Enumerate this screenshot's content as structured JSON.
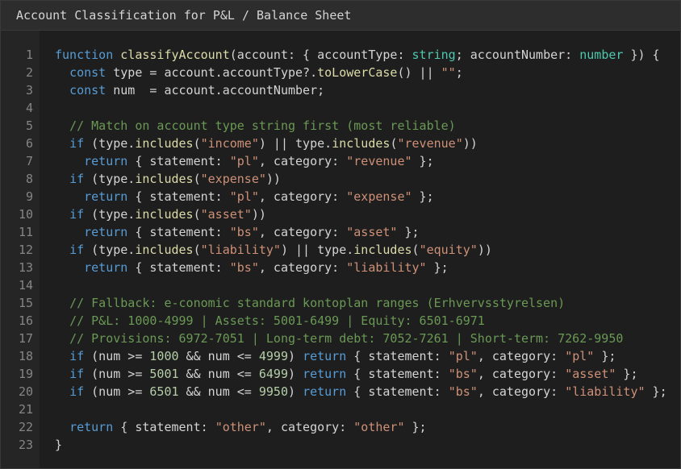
{
  "window": {
    "title": "Account Classification for P&L / Balance Sheet"
  },
  "editor": {
    "colors": {
      "keyword": "#569cd6",
      "function": "#dcdcaa",
      "type": "#4ec9b0",
      "string": "#ce9178",
      "comment": "#6a9955",
      "number": "#b5cea8",
      "plain": "#d4d4d4"
    },
    "lines": [
      [
        [
          "kw",
          "function"
        ],
        [
          "pl",
          " "
        ],
        [
          "fn",
          "classifyAccount"
        ],
        [
          "pl",
          "(account: { accountType: "
        ],
        [
          "ty",
          "string"
        ],
        [
          "pl",
          "; accountNumber: "
        ],
        [
          "ty",
          "number"
        ],
        [
          "pl",
          " }) {"
        ]
      ],
      [
        [
          "pl",
          "  "
        ],
        [
          "kw",
          "const"
        ],
        [
          "pl",
          " type = account.accountType?."
        ],
        [
          "fn",
          "toLowerCase"
        ],
        [
          "pl",
          "() || "
        ],
        [
          "st",
          "\"\""
        ],
        [
          "pl",
          ";"
        ]
      ],
      [
        [
          "pl",
          "  "
        ],
        [
          "kw",
          "const"
        ],
        [
          "pl",
          " num  = account.accountNumber;"
        ]
      ],
      [],
      [
        [
          "pl",
          "  "
        ],
        [
          "cm",
          "// Match on account type string first (most reliable)"
        ]
      ],
      [
        [
          "pl",
          "  "
        ],
        [
          "kw",
          "if"
        ],
        [
          "pl",
          " (type."
        ],
        [
          "fn",
          "includes"
        ],
        [
          "pl",
          "("
        ],
        [
          "st",
          "\"income\""
        ],
        [
          "pl",
          ") || type."
        ],
        [
          "fn",
          "includes"
        ],
        [
          "pl",
          "("
        ],
        [
          "st",
          "\"revenue\""
        ],
        [
          "pl",
          "))"
        ]
      ],
      [
        [
          "pl",
          "    "
        ],
        [
          "kw",
          "return"
        ],
        [
          "pl",
          " { statement: "
        ],
        [
          "st",
          "\"pl\""
        ],
        [
          "pl",
          ", category: "
        ],
        [
          "st",
          "\"revenue\""
        ],
        [
          "pl",
          " };"
        ]
      ],
      [
        [
          "pl",
          "  "
        ],
        [
          "kw",
          "if"
        ],
        [
          "pl",
          " (type."
        ],
        [
          "fn",
          "includes"
        ],
        [
          "pl",
          "("
        ],
        [
          "st",
          "\"expense\""
        ],
        [
          "pl",
          "))"
        ]
      ],
      [
        [
          "pl",
          "    "
        ],
        [
          "kw",
          "return"
        ],
        [
          "pl",
          " { statement: "
        ],
        [
          "st",
          "\"pl\""
        ],
        [
          "pl",
          ", category: "
        ],
        [
          "st",
          "\"expense\""
        ],
        [
          "pl",
          " };"
        ]
      ],
      [
        [
          "pl",
          "  "
        ],
        [
          "kw",
          "if"
        ],
        [
          "pl",
          " (type."
        ],
        [
          "fn",
          "includes"
        ],
        [
          "pl",
          "("
        ],
        [
          "st",
          "\"asset\""
        ],
        [
          "pl",
          "))"
        ]
      ],
      [
        [
          "pl",
          "    "
        ],
        [
          "kw",
          "return"
        ],
        [
          "pl",
          " { statement: "
        ],
        [
          "st",
          "\"bs\""
        ],
        [
          "pl",
          ", category: "
        ],
        [
          "st",
          "\"asset\""
        ],
        [
          "pl",
          " };"
        ]
      ],
      [
        [
          "pl",
          "  "
        ],
        [
          "kw",
          "if"
        ],
        [
          "pl",
          " (type."
        ],
        [
          "fn",
          "includes"
        ],
        [
          "pl",
          "("
        ],
        [
          "st",
          "\"liability\""
        ],
        [
          "pl",
          ") || type."
        ],
        [
          "fn",
          "includes"
        ],
        [
          "pl",
          "("
        ],
        [
          "st",
          "\"equity\""
        ],
        [
          "pl",
          "))"
        ]
      ],
      [
        [
          "pl",
          "    "
        ],
        [
          "kw",
          "return"
        ],
        [
          "pl",
          " { statement: "
        ],
        [
          "st",
          "\"bs\""
        ],
        [
          "pl",
          ", category: "
        ],
        [
          "st",
          "\"liability\""
        ],
        [
          "pl",
          " };"
        ]
      ],
      [],
      [
        [
          "pl",
          "  "
        ],
        [
          "cm",
          "// Fallback: e-conomic standard kontoplan ranges (Erhvervsstyrelsen)"
        ]
      ],
      [
        [
          "pl",
          "  "
        ],
        [
          "cm",
          "// P&L: 1000-4999 | Assets: 5001-6499 | Equity: 6501-6971"
        ]
      ],
      [
        [
          "pl",
          "  "
        ],
        [
          "cm",
          "// Provisions: 6972-7051 | Long-term debt: 7052-7261 | Short-term: 7262-9950"
        ]
      ],
      [
        [
          "pl",
          "  "
        ],
        [
          "kw",
          "if"
        ],
        [
          "pl",
          " (num >= "
        ],
        [
          "nu",
          "1000"
        ],
        [
          "pl",
          " && num <= "
        ],
        [
          "nu",
          "4999"
        ],
        [
          "pl",
          ") "
        ],
        [
          "kw",
          "return"
        ],
        [
          "pl",
          " { statement: "
        ],
        [
          "st",
          "\"pl\""
        ],
        [
          "pl",
          ", category: "
        ],
        [
          "st",
          "\"pl\""
        ],
        [
          "pl",
          " };"
        ]
      ],
      [
        [
          "pl",
          "  "
        ],
        [
          "kw",
          "if"
        ],
        [
          "pl",
          " (num >= "
        ],
        [
          "nu",
          "5001"
        ],
        [
          "pl",
          " && num <= "
        ],
        [
          "nu",
          "6499"
        ],
        [
          "pl",
          ") "
        ],
        [
          "kw",
          "return"
        ],
        [
          "pl",
          " { statement: "
        ],
        [
          "st",
          "\"bs\""
        ],
        [
          "pl",
          ", category: "
        ],
        [
          "st",
          "\"asset\""
        ],
        [
          "pl",
          " };"
        ]
      ],
      [
        [
          "pl",
          "  "
        ],
        [
          "kw",
          "if"
        ],
        [
          "pl",
          " (num >= "
        ],
        [
          "nu",
          "6501"
        ],
        [
          "pl",
          " && num <= "
        ],
        [
          "nu",
          "9950"
        ],
        [
          "pl",
          ") "
        ],
        [
          "kw",
          "return"
        ],
        [
          "pl",
          " { statement: "
        ],
        [
          "st",
          "\"bs\""
        ],
        [
          "pl",
          ", category: "
        ],
        [
          "st",
          "\"liability\""
        ],
        [
          "pl",
          " };"
        ]
      ],
      [],
      [
        [
          "pl",
          "  "
        ],
        [
          "kw",
          "return"
        ],
        [
          "pl",
          " { statement: "
        ],
        [
          "st",
          "\"other\""
        ],
        [
          "pl",
          ", category: "
        ],
        [
          "st",
          "\"other\""
        ],
        [
          "pl",
          " };"
        ]
      ],
      [
        [
          "pl",
          "}"
        ]
      ]
    ]
  }
}
